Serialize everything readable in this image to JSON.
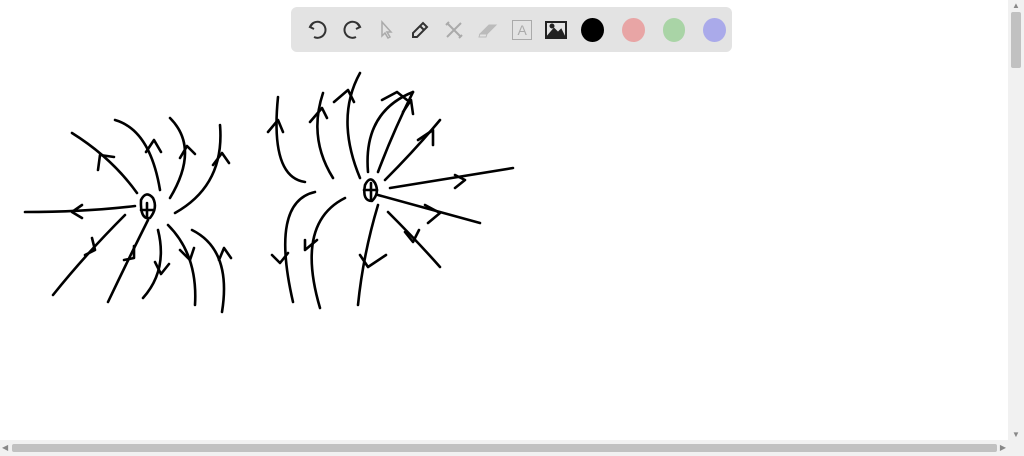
{
  "toolbar": {
    "tools": [
      "undo-icon",
      "redo-icon",
      "select-icon",
      "pen-icon",
      "tools-icon",
      "eraser-icon",
      "text-icon",
      "image-icon"
    ],
    "text_tool_glyph": "A",
    "colors": [
      "#000000",
      "#e8a5a5",
      "#a9d4a6",
      "#aaaaea"
    ]
  },
  "scroll": {
    "up": "▲",
    "down": "▼",
    "left": "◀",
    "right": "▶"
  }
}
